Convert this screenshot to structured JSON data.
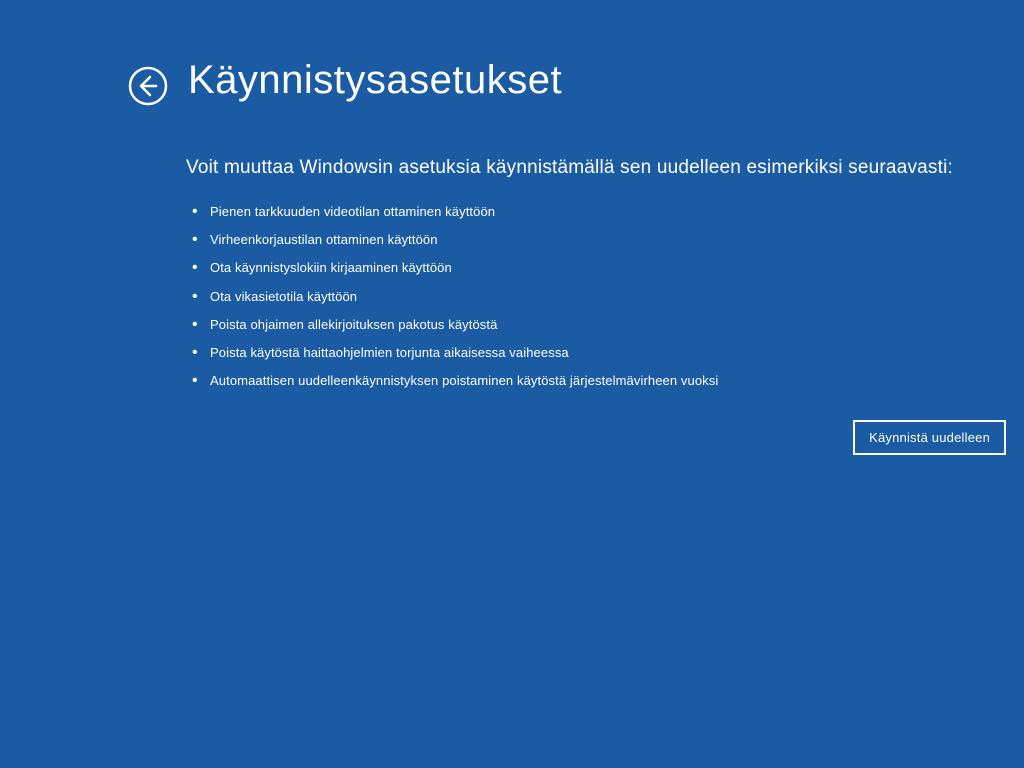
{
  "header": {
    "title": "Käynnistysasetukset"
  },
  "content": {
    "subtitle": "Voit muuttaa Windowsin asetuksia käynnistämällä sen uudelleen esimerkiksi seuraavasti:",
    "options": [
      "Pienen tarkkuuden videotilan ottaminen käyttöön",
      "Virheenkorjaustilan ottaminen käyttöön",
      "Ota käynnistyslokiin kirjaaminen käyttöön",
      "Ota vikasietotila käyttöön",
      "Poista ohjaimen allekirjoituksen pakotus käytöstä",
      "Poista käytöstä haittaohjelmien torjunta aikaisessa vaiheessa",
      "Automaattisen uudelleenkäynnistyksen poistaminen käytöstä järjestelmävirheen vuoksi"
    ]
  },
  "buttons": {
    "restart": "Käynnistä uudelleen"
  }
}
